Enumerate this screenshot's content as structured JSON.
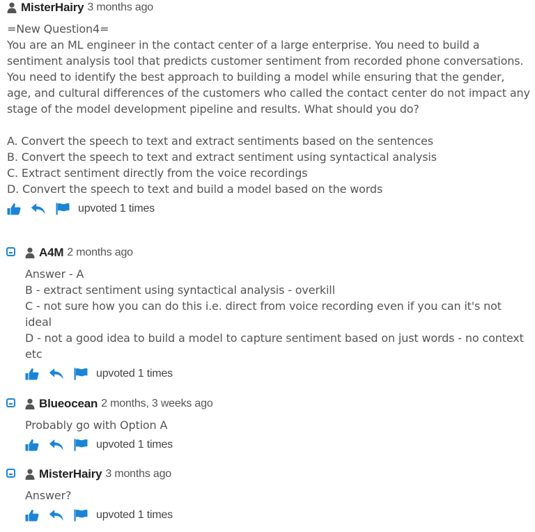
{
  "main_comment": {
    "username": "MisterHairy",
    "date": "3 months ago",
    "body": "=New Question4=\nYou are an ML engineer in the contact center of a large enterprise. You need to build a sentiment analysis tool that predicts customer sentiment from recorded phone conversations. You need to identify the best approach to building a model while ensuring that the gender, age, and cultural differences of the customers who called the contact center do not impact any stage of the model development pipeline and results. What should you do?\n\nA. Convert the speech to text and extract sentiments based on the sentences\nB. Convert the speech to text and extract sentiment using syntactical analysis\nC. Extract sentiment directly from the voice recordings\nD. Convert the speech to text and build a model based on the words",
    "upvoted": "upvoted 1 times"
  },
  "replies": [
    {
      "username": "A4M",
      "date": "2 months ago",
      "body": "Answer - A\nB - extract sentiment using syntactical analysis - overkill\nC - not sure how you can do this i.e. direct from voice recording even if you can it's not ideal\nD - not a good idea to build a model to capture sentiment based on just words - no context etc",
      "upvoted": "upvoted 1 times"
    },
    {
      "username": "Blueocean",
      "date": "2 months, 3 weeks ago",
      "body": "Probably go with Option A",
      "upvoted": "upvoted 1 times"
    },
    {
      "username": "MisterHairy",
      "date": "3 months ago",
      "body": "Answer?",
      "upvoted": "upvoted 1 times"
    }
  ],
  "colors": {
    "accent": "#1a85d6",
    "text": "#555555",
    "username": "#222222"
  }
}
